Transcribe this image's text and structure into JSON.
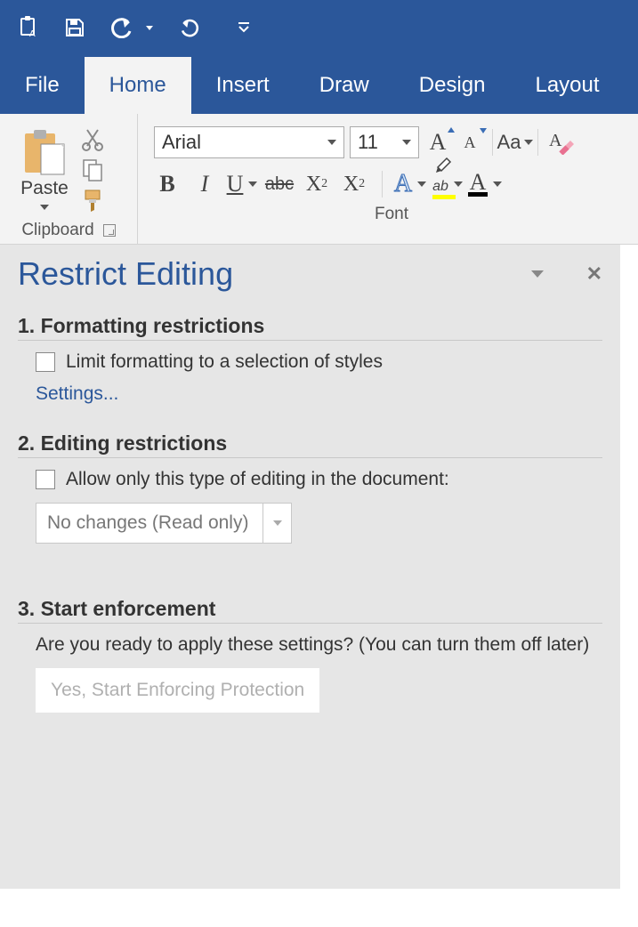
{
  "qat": {
    "undo_label": "Undo",
    "redo_label": "Redo"
  },
  "tabs": [
    "File",
    "Home",
    "Insert",
    "Draw",
    "Design",
    "Layout"
  ],
  "active_tab": "Home",
  "ribbon": {
    "clipboard": {
      "paste_label": "Paste",
      "group_label": "Clipboard"
    },
    "font": {
      "group_label": "Font",
      "font_name": "Arial",
      "font_size": "11",
      "case_label": "Aa",
      "bold": "B",
      "italic": "I",
      "underline": "U",
      "strike": "abc",
      "subscript": "X",
      "superscript": "X",
      "text_effects": "A",
      "highlight": "ab",
      "font_color": "A"
    }
  },
  "pane": {
    "title": "Restrict Editing",
    "section1": {
      "heading": "1. Formatting restrictions",
      "checkbox_label": "Limit formatting to a selection of styles",
      "settings_link": "Settings..."
    },
    "section2": {
      "heading": "2. Editing restrictions",
      "checkbox_label": "Allow only this type of editing in the document:",
      "dropdown_value": "No changes (Read only)"
    },
    "section3": {
      "heading": "3. Start enforcement",
      "body": "Are you ready to apply these settings? (You can turn them off later)",
      "button_label": "Yes, Start Enforcing Protection"
    }
  }
}
